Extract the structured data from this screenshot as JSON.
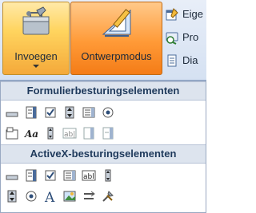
{
  "ribbon": {
    "insert_label": "Invoegen",
    "design_mode_label": "Ontwerpmodus",
    "small_buttons": [
      {
        "label": "Eige",
        "icon": "properties-icon"
      },
      {
        "label": "Pro",
        "icon": "view-code-icon"
      },
      {
        "label": "Dia",
        "icon": "dialog-icon"
      }
    ]
  },
  "panel": {
    "form_controls_header": "Formulierbesturingselementen",
    "activex_header": "ActiveX-besturingselementen",
    "form_row1": [
      "button-control-icon",
      "combo-box-icon",
      "checkbox-icon",
      "spin-button-icon",
      "list-box-icon",
      "option-button-icon"
    ],
    "form_row2": [
      "group-box-icon",
      "label-icon",
      "scroll-bar-icon",
      "text-field-icon",
      "combo-list-edit-icon",
      "combo-dropdown-edit-icon"
    ],
    "activex_row1": [
      "command-button-icon",
      "combo-box-icon",
      "checkbox-icon",
      "list-box-icon",
      "text-box-icon",
      "scroll-bar-icon"
    ],
    "activex_row2": [
      "spin-button-icon",
      "option-button-icon",
      "label-icon",
      "image-icon",
      "toggle-button-icon",
      "more-controls-icon"
    ]
  }
}
